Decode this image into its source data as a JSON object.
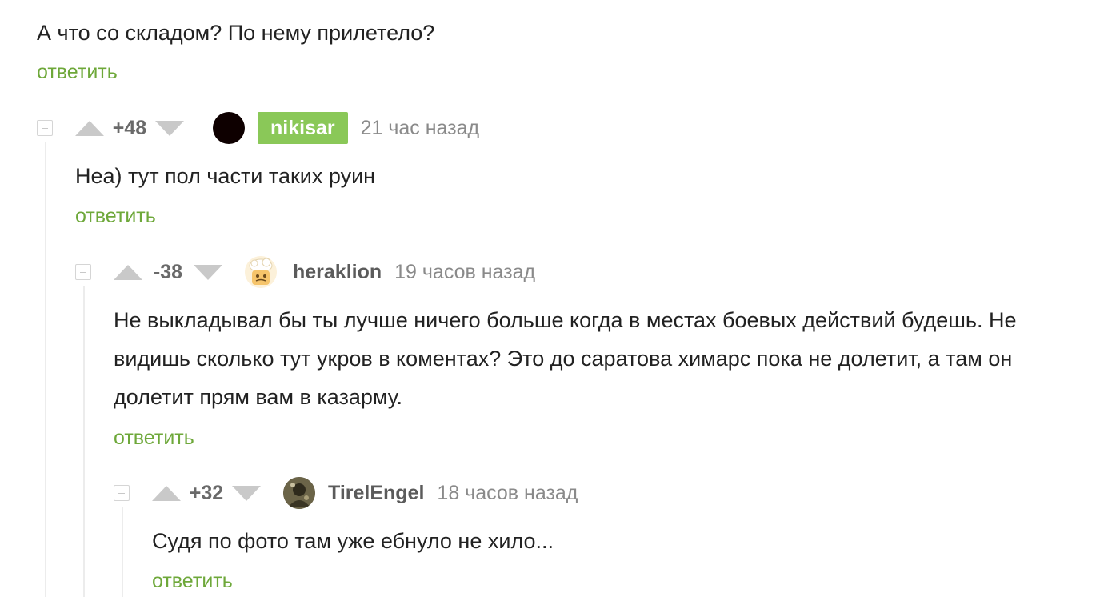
{
  "reply_label": "ответить",
  "parent_comment": {
    "text": "А что со складом? По нему прилетело?"
  },
  "comments": [
    {
      "rating": "+48",
      "username": "nikisar",
      "is_author": true,
      "time": "21 час назад",
      "text": "Неа) тут пол части таких руин"
    },
    {
      "rating": "-38",
      "username": "heraklion",
      "is_author": false,
      "time": "19 часов назад",
      "text_lines": [
        "Не выкладывал бы ты лучше ничего больше когда в местах боевых действий будешь. Не",
        "видишь сколько тут укров в коментах? Это до саратова химарс пока не долетит, а там он",
        "долетит прям вам в казарму."
      ]
    },
    {
      "rating": "+32",
      "username": "TirelEngel",
      "is_author": false,
      "time": "18 часов назад",
      "text": "Судя по фото там уже ебнуло не хило..."
    }
  ],
  "colors": {
    "reply_link": "#6ea83a",
    "author_badge": "#8ac858",
    "vote_arrow": "#c9c9c9",
    "branch_line": "#ececec"
  },
  "icons": {
    "vote_up": "triangle-up-icon",
    "vote_down": "triangle-down-icon",
    "collapse": "minus-square-icon"
  }
}
